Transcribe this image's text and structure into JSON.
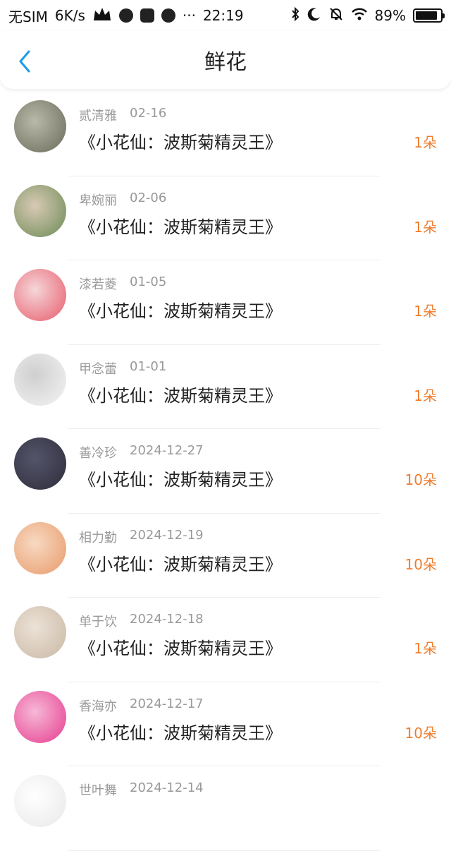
{
  "status_bar": {
    "carrier": "无SIM",
    "speed": "6K/s",
    "more": "···",
    "time": "22:19",
    "battery_text": "89%",
    "battery_level": 0.89
  },
  "header": {
    "title": "鲜花"
  },
  "items": [
    {
      "name": "贰清雅",
      "date": "02-16",
      "title": "《小花仙：波斯菊精灵王》",
      "amount": "1朵",
      "avatar_colors": [
        "#6a6a5a",
        "#b9b9a9"
      ]
    },
    {
      "name": "卑婉丽",
      "date": "02-06",
      "title": "《小花仙：波斯菊精灵王》",
      "amount": "1朵",
      "avatar_colors": [
        "#6b8a55",
        "#d8c9b4"
      ]
    },
    {
      "name": "漆若菱",
      "date": "01-05",
      "title": "《小花仙：波斯菊精灵王》",
      "amount": "1朵",
      "avatar_colors": [
        "#e85a6b",
        "#f5d6d8"
      ]
    },
    {
      "name": "甲念蕾",
      "date": "01-01",
      "title": "《小花仙：波斯菊精灵王》",
      "amount": "1朵",
      "avatar_colors": [
        "#f4f4f4",
        "#cfcfcf"
      ]
    },
    {
      "name": "善冷珍",
      "date": "2024-12-27",
      "title": "《小花仙：波斯菊精灵王》",
      "amount": "10朵",
      "avatar_colors": [
        "#2c2c3a",
        "#55556a"
      ]
    },
    {
      "name": "相力勤",
      "date": "2024-12-19",
      "title": "《小花仙：波斯菊精灵王》",
      "amount": "10朵",
      "avatar_colors": [
        "#e89a6a",
        "#f7d9c2"
      ]
    },
    {
      "name": "单于饮",
      "date": "2024-12-18",
      "title": "《小花仙：波斯菊精灵王》",
      "amount": "1朵",
      "avatar_colors": [
        "#c9b7a3",
        "#ece2d7"
      ]
    },
    {
      "name": "香海亦",
      "date": "2024-12-17",
      "title": "《小花仙：波斯菊精灵王》",
      "amount": "10朵",
      "avatar_colors": [
        "#e63b8f",
        "#f6b8d6"
      ]
    },
    {
      "name": "世叶舞",
      "date": "2024-12-14",
      "title": "",
      "amount": "",
      "avatar_colors": [
        "#e8e8e8",
        "#ffffff"
      ]
    }
  ],
  "colors": {
    "accent": "#1a9be8",
    "amount": "#f07c2c",
    "meta": "#999999"
  }
}
